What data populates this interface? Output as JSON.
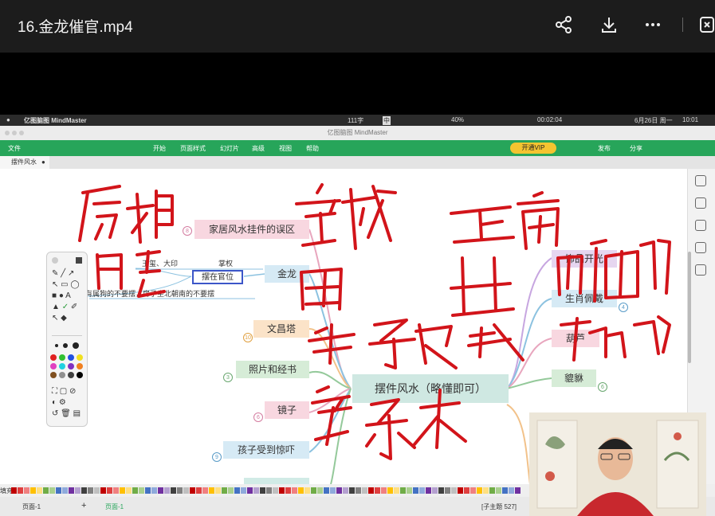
{
  "player": {
    "title": "16.金龙催官.mp4",
    "icons": [
      "share-icon",
      "download-icon",
      "more-icon",
      "exit-icon"
    ]
  },
  "mac_menubar": {
    "app_name": "亿图脑图 MindMaster",
    "left_num": "111字",
    "lang_icon": "中",
    "battery": "40%",
    "timer": "00:02:04",
    "date": "6月26日 周一",
    "time": "10:01"
  },
  "window": {
    "title": "亿图脑图 MindMaster"
  },
  "toolbar": {
    "file": "文件",
    "menus": [
      "开始",
      "页面样式",
      "幻灯片",
      "高级",
      "视图",
      "帮助"
    ],
    "vip": "开通VIP",
    "publish": "发布",
    "share": "分享"
  },
  "doc_tab": {
    "label": "摆件风水"
  },
  "mindmap": {
    "center": "摆件风水（略懂即可）",
    "left_branches": [
      {
        "label": "家居风水挂件的误区",
        "num": "8"
      },
      {
        "label": "金龙"
      },
      {
        "label": "文昌塔",
        "num": "10"
      },
      {
        "label": "照片和经书",
        "num": "3"
      },
      {
        "label": "镜子",
        "num": "6"
      },
      {
        "label": "孩子受到惊吓",
        "num": "9"
      }
    ],
    "dragon_sub": {
      "selected": "摆在官位",
      "item1": "玉玺、大印",
      "item2": "掌权",
      "item3": "若有属狗的不要摆，房子坐北朝南的不要摆"
    },
    "right_branches": [
      {
        "label": "饰品开光"
      },
      {
        "label": "生肖佩戴",
        "num": "4"
      },
      {
        "label": "葫芦"
      },
      {
        "label": "貔貅",
        "num": "6"
      }
    ]
  },
  "status": {
    "page_select": "页面-1",
    "add": "+",
    "page_tab": "页面-1",
    "fill_label": "填充",
    "subtopic": "[子主题 527]"
  },
  "colors": {
    "accent_green": "#27a55a",
    "ink_red": "#d2141a",
    "vip_yellow": "#f4c430",
    "selection_blue": "#3c56c8"
  }
}
